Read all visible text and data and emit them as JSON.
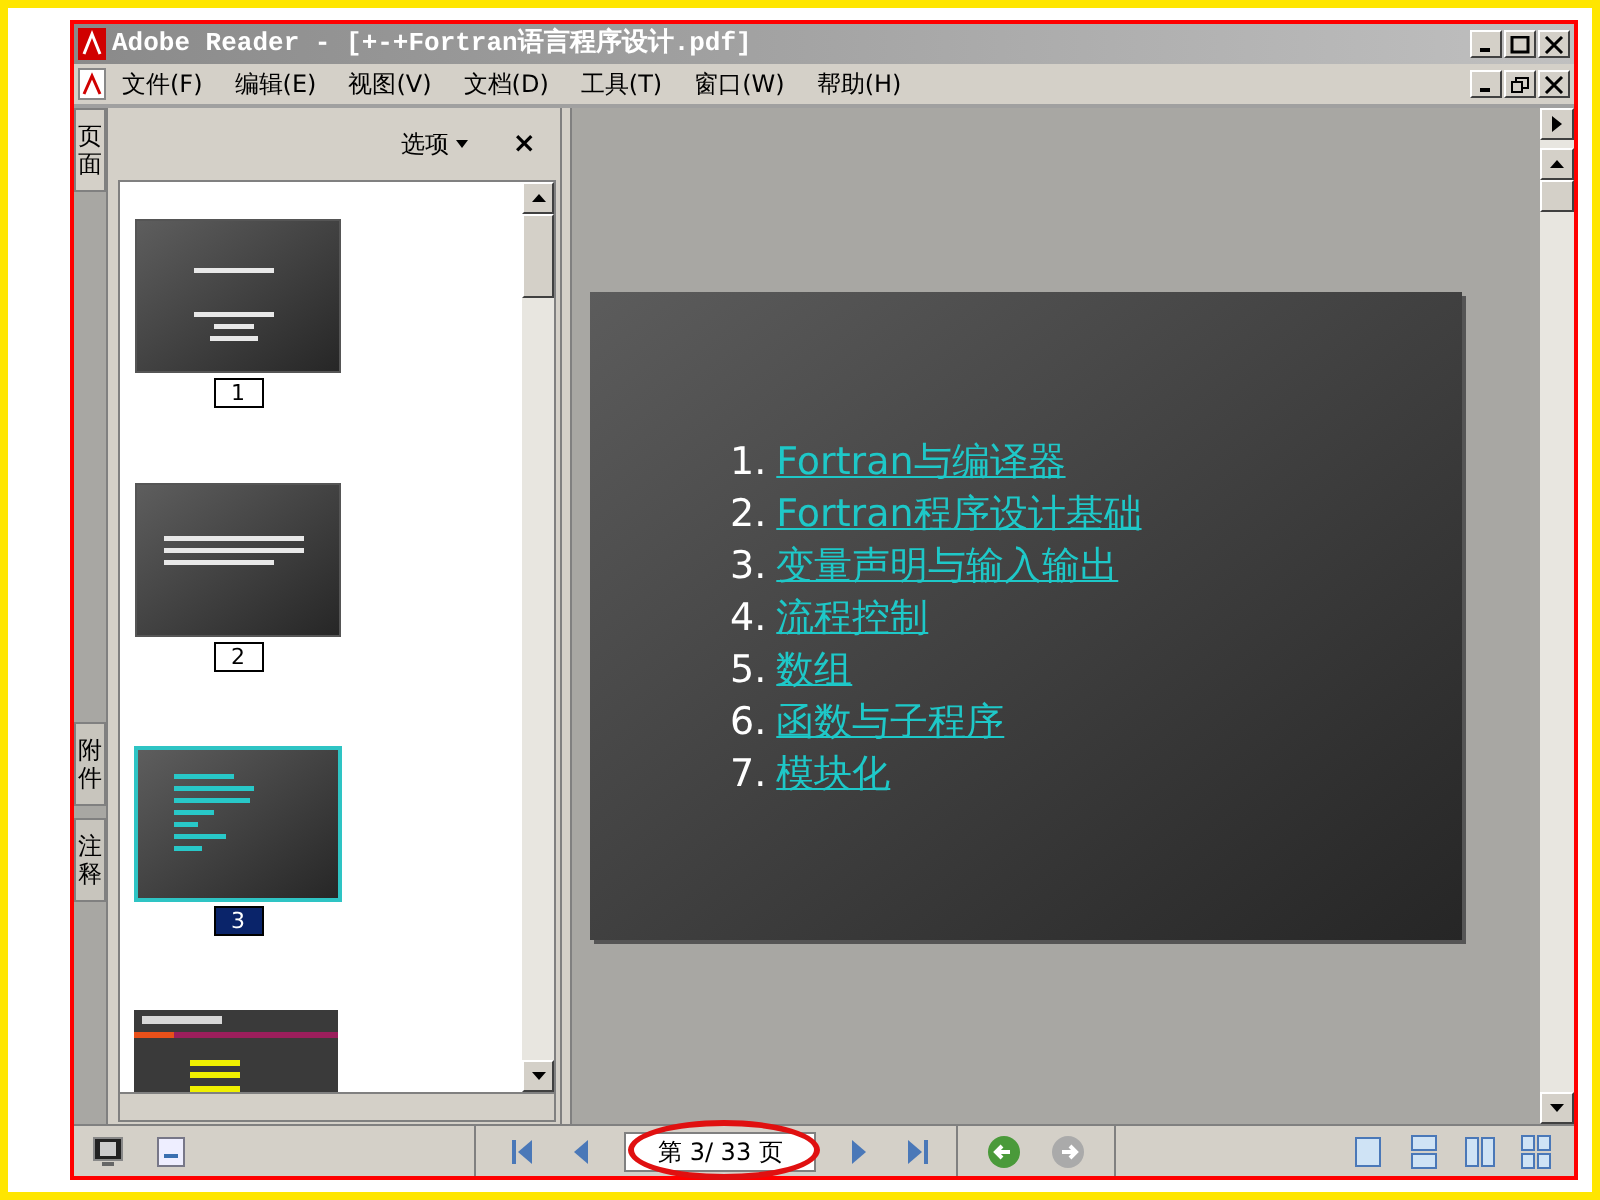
{
  "window": {
    "title": "Adobe Reader - [+-+Fortran语言程序设计.pdf]"
  },
  "menu": [
    "文件(F)",
    "编辑(E)",
    "视图(V)",
    "文档(D)",
    "工具(T)",
    "窗口(W)",
    "帮助(H)"
  ],
  "side_tabs": [
    {
      "label": "页面",
      "selected": true
    },
    {
      "label": "附件",
      "selected": false
    },
    {
      "label": "注释",
      "selected": false
    }
  ],
  "panel": {
    "options": "选项",
    "close": "×"
  },
  "thumbnails": [
    {
      "kind": "title",
      "label": "1",
      "selected": false
    },
    {
      "kind": "text",
      "label": "2",
      "selected": false
    },
    {
      "kind": "list",
      "label": "3",
      "selected": true
    },
    {
      "kind": "section"
    }
  ],
  "slide": {
    "items": [
      {
        "number": "1.",
        "text": "Fortran与编译器"
      },
      {
        "number": "2.",
        "text": "Fortran程序设计基础"
      },
      {
        "number": "3.",
        "text": "变量声明与输入输出"
      },
      {
        "number": "4.",
        "text": "流程控制"
      },
      {
        "number": "5.",
        "text": "数组"
      },
      {
        "number": "6.",
        "text": "函数与子程序"
      },
      {
        "number": "7.",
        "text": "模块化"
      }
    ]
  },
  "page_field": {
    "value": "第 3/ 33 页"
  }
}
